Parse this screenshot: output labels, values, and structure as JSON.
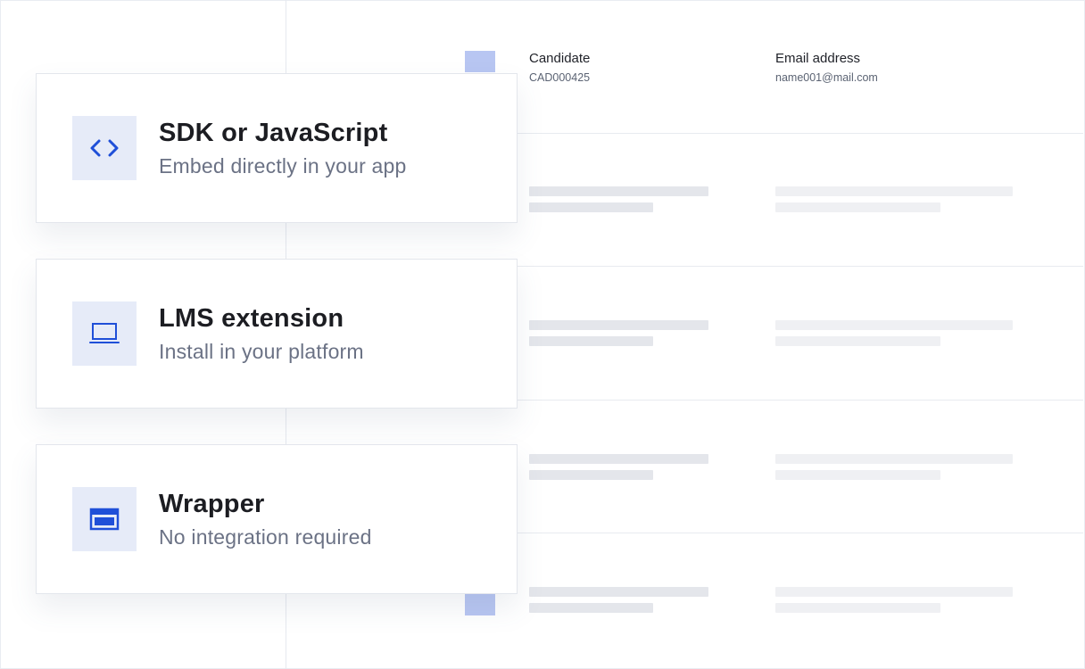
{
  "table": {
    "headers": [
      {
        "label": "Candidate",
        "value": "CAD000425"
      },
      {
        "label": "Email address",
        "value": "name001@mail.com"
      }
    ]
  },
  "options": [
    {
      "title": "SDK or JavaScript",
      "subtitle": "Embed directly in your app",
      "icon": "code-icon"
    },
    {
      "title": "LMS extension",
      "subtitle": "Install in your platform",
      "icon": "laptop-icon"
    },
    {
      "title": "Wrapper",
      "subtitle": "No integration required",
      "icon": "browser-window-icon"
    }
  ],
  "colors": {
    "accent": "#1f4fd8",
    "accent_light": "#b8c6f2",
    "icon_background": "#e6ebf8"
  }
}
